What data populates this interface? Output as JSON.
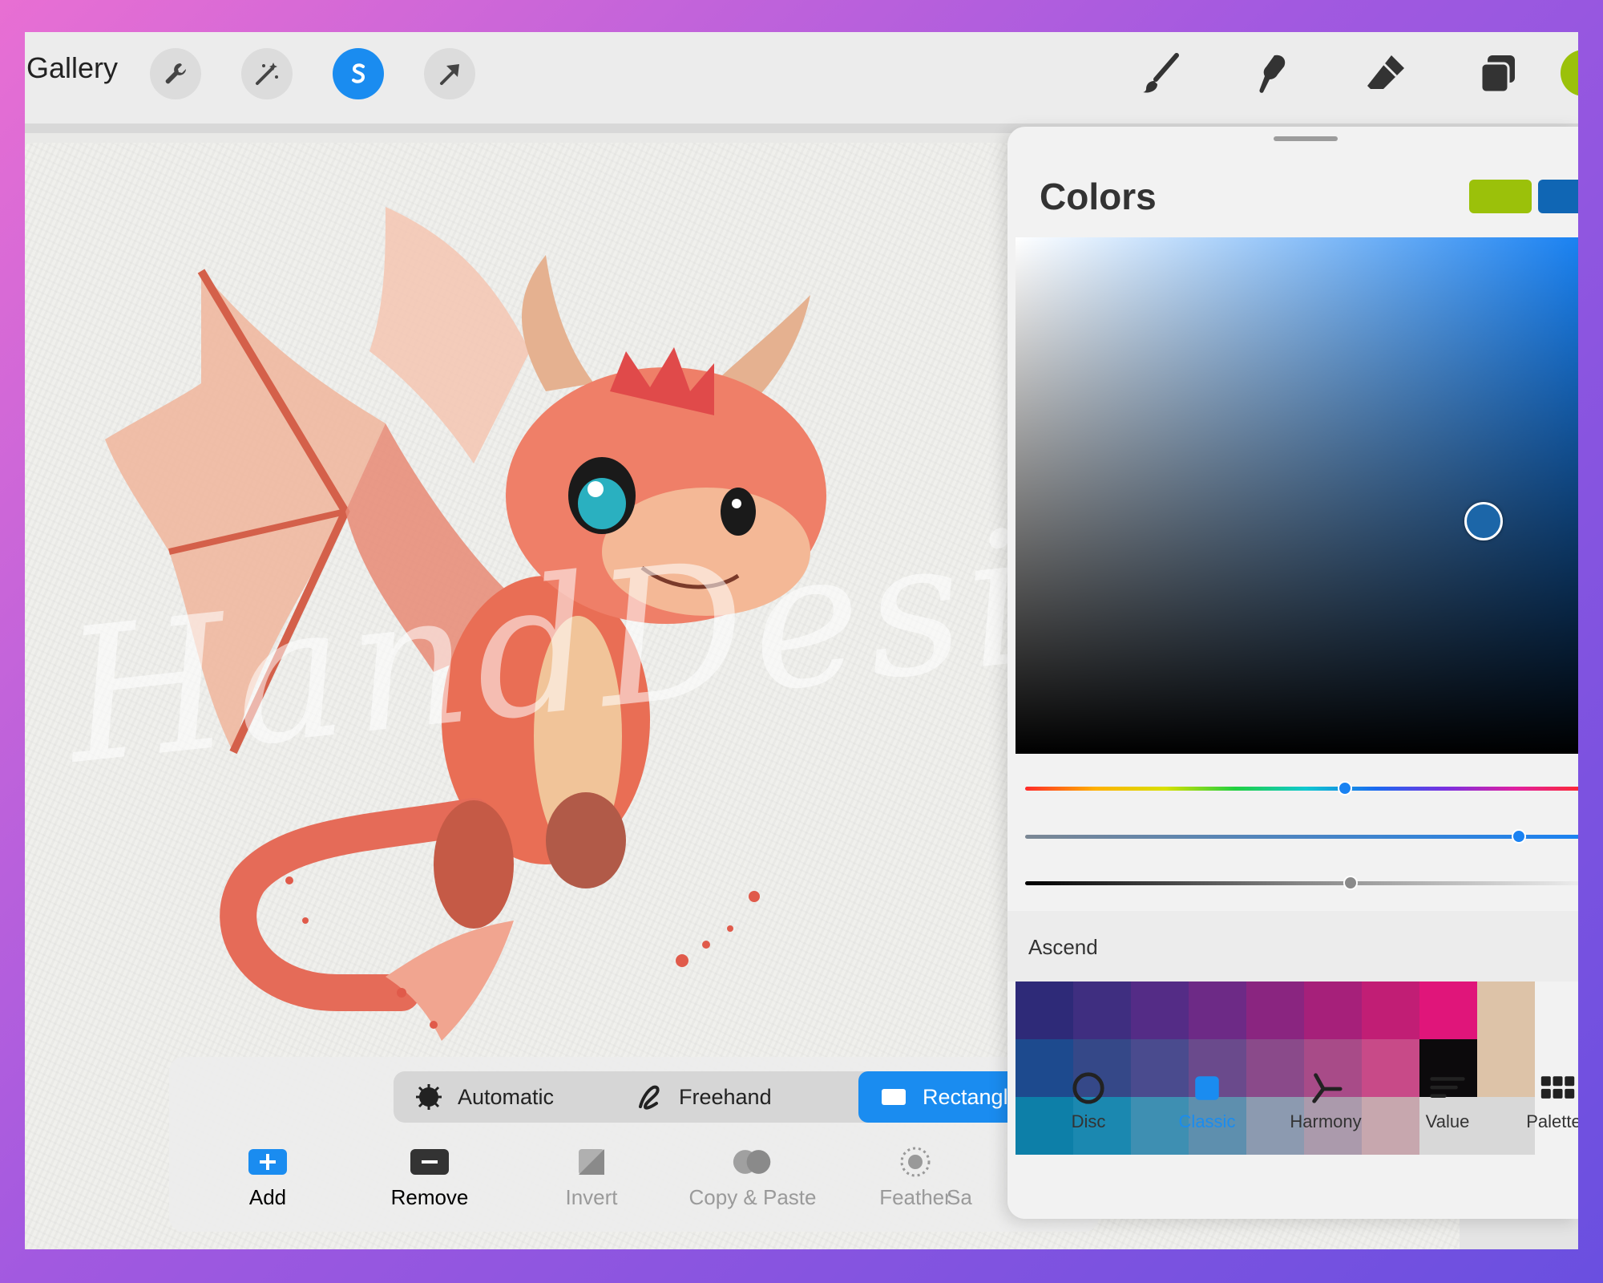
{
  "toolbar": {
    "gallery_label": "Gallery",
    "left_tools": [
      {
        "icon": "wrench-icon"
      },
      {
        "icon": "magic-wand-icon"
      },
      {
        "icon": "selection-s-icon",
        "active": true
      },
      {
        "icon": "transform-arrow-icon"
      }
    ],
    "right_tools": [
      {
        "icon": "brush-icon"
      },
      {
        "icon": "smudge-icon"
      },
      {
        "icon": "eraser-icon"
      },
      {
        "icon": "layers-icon"
      }
    ],
    "current_color": "#9bc10a"
  },
  "canvas": {
    "watermark": "HandDesign ID"
  },
  "selection": {
    "modes": [
      {
        "label": "Automatic",
        "icon": "sun-burst-icon"
      },
      {
        "label": "Freehand",
        "icon": "freehand-icon"
      },
      {
        "label": "Rectangle",
        "icon": "rectangle-icon",
        "active": true
      }
    ],
    "actions": [
      {
        "label": "Add",
        "icon": "plus-icon",
        "enabled": true
      },
      {
        "label": "Remove",
        "icon": "minus-icon",
        "enabled": true
      },
      {
        "label": "Invert",
        "icon": "invert-icon",
        "enabled": false
      },
      {
        "label": "Copy & Paste",
        "icon": "copy-paste-icon",
        "enabled": false
      },
      {
        "label": "Feather",
        "icon": "feather-icon",
        "enabled": false
      },
      {
        "label": "Sa",
        "icon": "",
        "enabled": false
      }
    ]
  },
  "colors": {
    "title": "Colors",
    "primary_swatch": "#9bc10a",
    "secondary_swatch": "#1066b4",
    "selected_color": "#1c66a8",
    "hue_level": 0.57,
    "saturation_level": 0.88,
    "brightness_level": 0.58,
    "palette_name": "Ascend",
    "palette_rows": [
      [
        "#2e2a78",
        "#3f2e80",
        "#542c86",
        "#6d2a86",
        "#8a2580",
        "#a6207a",
        "#c11e75",
        "#e0157a",
        "#ddc3a8"
      ],
      [
        "#1d4a8e",
        "#354888",
        "#4a4b8e",
        "#6a4a8c",
        "#8a4a8a",
        "#a84b88",
        "#c84a88",
        "#0c0a0c",
        "#ddc3a8"
      ],
      [
        "#0d7fa8",
        "#1b88b0",
        "#3e8fb2",
        "#5e8fae",
        "#8c9ab0",
        "#ab9aac",
        "#c7a7ae",
        "#d8d8d8",
        "#d8d8d8"
      ]
    ],
    "tabs": [
      {
        "label": "Disc",
        "icon": "disc-icon"
      },
      {
        "label": "Classic",
        "icon": "classic-square-icon",
        "active": true
      },
      {
        "label": "Harmony",
        "icon": "harmony-icon"
      },
      {
        "label": "Value",
        "icon": "value-bars-icon"
      },
      {
        "label": "Palettes",
        "icon": "palettes-grid-icon"
      }
    ]
  }
}
